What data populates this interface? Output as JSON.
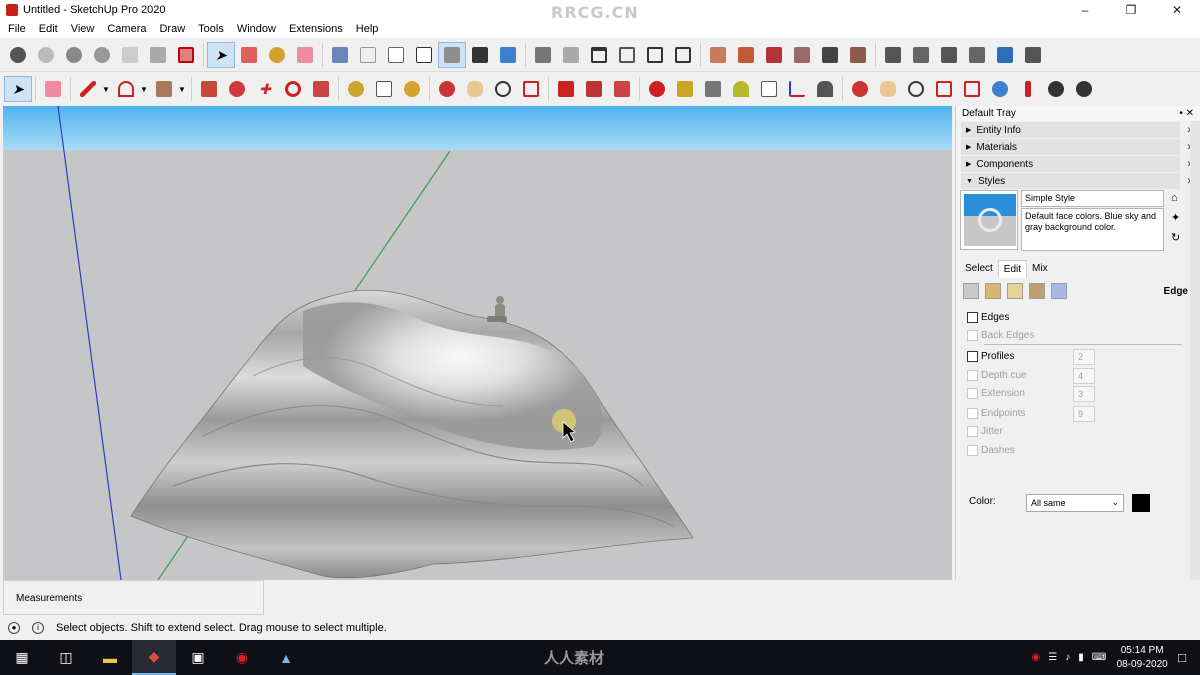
{
  "window": {
    "title": "Untitled - SketchUp Pro 2020",
    "watermark": "RRCG.CN"
  },
  "menu": [
    "File",
    "Edit",
    "View",
    "Camera",
    "Draw",
    "Tools",
    "Window",
    "Extensions",
    "Help"
  ],
  "tray": {
    "title": "Default Tray",
    "panels": [
      {
        "label": "Entity Info",
        "expanded": false
      },
      {
        "label": "Materials",
        "expanded": false
      },
      {
        "label": "Components",
        "expanded": false
      },
      {
        "label": "Styles",
        "expanded": true
      }
    ],
    "style": {
      "name": "Simple Style",
      "description": "Default face colors. Blue sky and gray background color."
    },
    "tabs": [
      "Select",
      "Edit",
      "Mix"
    ],
    "active_tab": "Edit",
    "section_label": "Edge",
    "edge_settings": [
      {
        "label": "Edges",
        "enabled": true,
        "checked": false
      },
      {
        "label": "Back Edges",
        "enabled": false,
        "checked": false
      },
      {
        "label": "Profiles",
        "enabled": true,
        "checked": false,
        "value": "2"
      },
      {
        "label": "Depth cue",
        "enabled": false,
        "checked": false,
        "value": "4"
      },
      {
        "label": "Extension",
        "enabled": false,
        "checked": false,
        "value": "3"
      },
      {
        "label": "Endpoints",
        "enabled": false,
        "checked": false,
        "value": "9"
      },
      {
        "label": "Jitter",
        "enabled": false,
        "checked": false
      },
      {
        "label": "Dashes",
        "enabled": false,
        "checked": false
      }
    ],
    "color_label": "Color:",
    "color_value": "All same",
    "color_swatch": "#000000"
  },
  "measurements_label": "Measurements",
  "status_text": "Select objects. Shift to extend select. Drag mouse to select multiple.",
  "taskbar": {
    "watermark": "人人素材",
    "time": "05:14 PM",
    "date": "08-09-2020"
  },
  "colors": {
    "sky_top": "#4fb3ee",
    "ground": "#c6c6c8",
    "red_axis": "#c8201a",
    "green_axis": "#37a24a",
    "blue_axis": "#2a3fc4"
  }
}
